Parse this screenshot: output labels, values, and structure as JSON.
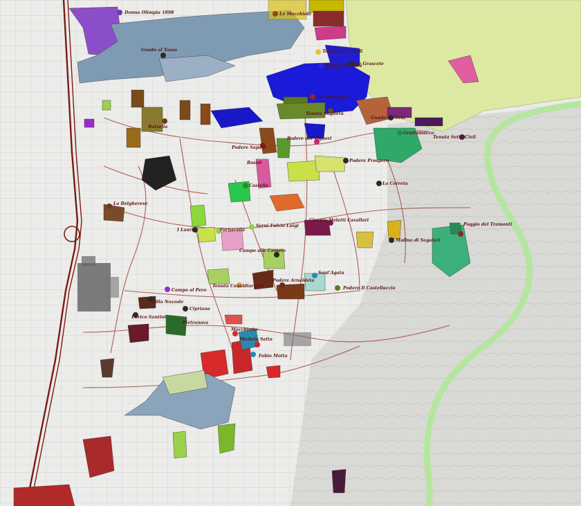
{
  "colors": {
    "background": "#e9e9e6",
    "hills": "#dfe8a6",
    "park_border": "#b9e6a0",
    "grid": "#c8c8c4",
    "road": "#a0463c",
    "highway": "#7a1a14",
    "label": "#5a1410",
    "town": "#2a2a2a"
  },
  "labels": [
    "Donna Olimpia 1898",
    "Le Macchiole",
    "Guado al Tasso",
    "Tenuta Dei Vitali",
    "Tenuta Di Vaira",
    "Le Grascete",
    "Cà Marcanda",
    "Tenuta Sughera",
    "Guado al Melo",
    "Batzella",
    "Podere Sapaio",
    "Podere dei Vigneri",
    "Podere Prospero",
    "Grattamacco",
    "Tenuta Sette Cieli",
    "Rosoli",
    "La Cerreta",
    "Castello",
    "La Belgherese",
    "I Lauri",
    "Fornacelle",
    "Serni Fulvio Luigi",
    "Giorgio Meletti Cavallari",
    "Mulino di Segalari",
    "Poggio del Tramonti",
    "Campo alle Comete",
    "Tenuta Canaldiargine",
    "Podere Arnaldeta",
    "Sant'Agata",
    "Podere Il Castellaccio",
    "Campo al Pero",
    "Villa Nozzole",
    "Cipriana",
    "Enrico Santini",
    "Pietranova",
    "Michele Satta",
    "Fabio Motta",
    "Macchietto"
  ]
}
